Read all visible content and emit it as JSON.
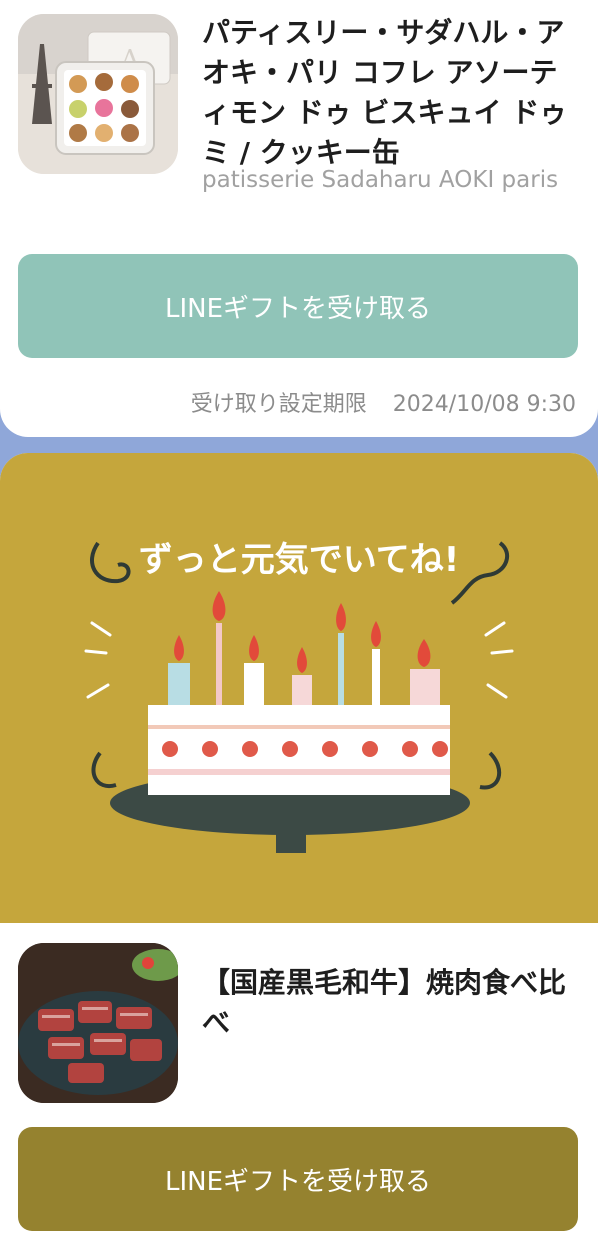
{
  "gift1": {
    "title": "パティスリー・サダハル・アオキ・パリ コフレ アソーティモン ドゥ ビスキュイ ドゥミ / クッキー缶",
    "brand": "patisserie Sadaharu AOKI paris",
    "cta_label": "LINEギフトを受け取る",
    "deadline_label": "受け取り設定期限",
    "deadline_value": "2024/10/08 9:30"
  },
  "message_card": {
    "message": "ずっと元気でいてね!",
    "background_color": "#c5a63c"
  },
  "gift2": {
    "title": "【国産黒毛和牛】焼肉食べ比べ",
    "cta_label": "LINEギフトを受け取る"
  },
  "colors": {
    "page_bg": "#8fa7d9",
    "cta1": "#90c4b8",
    "cta2": "#95822f"
  }
}
